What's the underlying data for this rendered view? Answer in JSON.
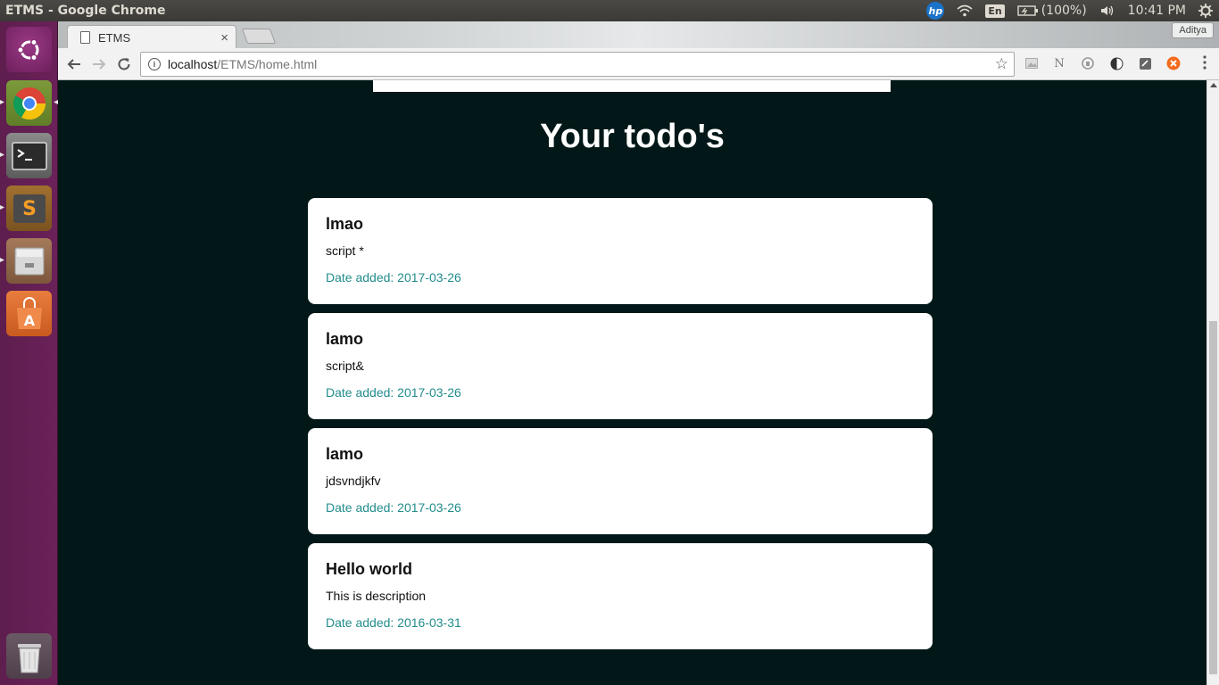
{
  "system": {
    "window_title": "ETMS - Google Chrome",
    "battery": "(100%)",
    "clock": "10:41 PM",
    "keyboard_layout": "En",
    "hp_label": "hp"
  },
  "browser": {
    "tab_title": "ETMS",
    "tab_close": "×",
    "profile_name": "Aditya",
    "url_host": "localhost",
    "url_path": "/ETMS/home.html"
  },
  "page": {
    "heading": "Your todo's",
    "todos": [
      {
        "title": "lmao",
        "description": "script *",
        "date": "Date added: 2017-03-26"
      },
      {
        "title": "lamo",
        "description": "script&",
        "date": "Date added: 2017-03-26"
      },
      {
        "title": "lamo",
        "description": "jdsvndjkfv",
        "date": "Date added: 2017-03-26"
      },
      {
        "title": "Hello world",
        "description": "This is description",
        "date": "Date added: 2016-03-31"
      }
    ]
  },
  "colors": {
    "page_background": "#021818",
    "card_background": "#ffffff",
    "date_text": "#238c8c",
    "launcher": "#6a2158"
  },
  "icons": [
    "ubuntu-logo-icon",
    "chrome-icon",
    "terminal-icon",
    "sublime-text-icon",
    "file-manager-icon",
    "software-center-icon",
    "trash-icon",
    "wifi-icon",
    "battery-icon",
    "volume-icon",
    "settings-gear-icon",
    "back-arrow-icon",
    "forward-arrow-icon",
    "reload-icon",
    "info-icon",
    "star-icon",
    "menu-dots-icon"
  ]
}
